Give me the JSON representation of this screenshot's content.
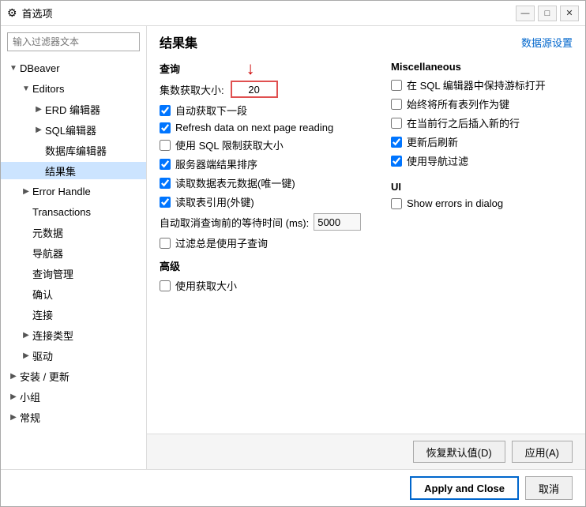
{
  "window": {
    "title": "首选项",
    "icon": "⚙"
  },
  "search": {
    "placeholder": "输入过滤器文本"
  },
  "sidebar": {
    "items": [
      {
        "id": "dbeaver",
        "label": "DBeaver",
        "level": 1,
        "expanded": true,
        "expandIcon": "▼"
      },
      {
        "id": "editors",
        "label": "Editors",
        "level": 2,
        "expanded": true,
        "expandIcon": "▼"
      },
      {
        "id": "erd",
        "label": "ERD 编辑器",
        "level": 3,
        "expandIcon": ""
      },
      {
        "id": "sql",
        "label": "SQL编辑器",
        "level": 3,
        "expandIcon": ""
      },
      {
        "id": "dbeditor",
        "label": "数据库编辑器",
        "level": 3,
        "expandIcon": ""
      },
      {
        "id": "results",
        "label": "结果集",
        "level": 3,
        "expandIcon": "",
        "selected": true
      },
      {
        "id": "errorhandle",
        "label": "Error Handle",
        "level": 2,
        "expandIcon": "▶"
      },
      {
        "id": "transactions",
        "label": "Transactions",
        "level": 2,
        "expandIcon": ""
      },
      {
        "id": "metadata",
        "label": "元数据",
        "level": 2,
        "expandIcon": ""
      },
      {
        "id": "navigator",
        "label": "导航器",
        "level": 2,
        "expandIcon": ""
      },
      {
        "id": "querymanager",
        "label": "查询管理",
        "level": 2,
        "expandIcon": ""
      },
      {
        "id": "confirm",
        "label": "确认",
        "level": 2,
        "expandIcon": ""
      },
      {
        "id": "connect",
        "label": "连接",
        "level": 2,
        "expandIcon": ""
      },
      {
        "id": "connecttype",
        "label": "连接类型",
        "level": 2,
        "expandIcon": "▶"
      },
      {
        "id": "driver",
        "label": "驱动",
        "level": 2,
        "expandIcon": "▶"
      },
      {
        "id": "install",
        "label": "安装 / 更新",
        "level": 1,
        "expandIcon": "▶"
      },
      {
        "id": "group",
        "label": "小组",
        "level": 1,
        "expandIcon": "▶"
      },
      {
        "id": "general",
        "label": "常规",
        "level": 1,
        "expandIcon": "▶"
      }
    ]
  },
  "panel": {
    "title": "结果集",
    "datasource_link": "数据源设置",
    "query_section": "查询",
    "fetch_size_label": "集数获取大小:",
    "fetch_size_value": "20",
    "checkboxes_left": [
      {
        "id": "auto_fetch",
        "label": "自动获取下一段",
        "checked": true
      },
      {
        "id": "refresh_data",
        "label": "Refresh data on next page reading",
        "checked": true
      },
      {
        "id": "sql_limit",
        "label": "使用 SQL 限制获取大小",
        "checked": false
      },
      {
        "id": "server_sort",
        "label": "服务器端结果排序",
        "checked": true
      },
      {
        "id": "read_metadata",
        "label": "读取数据表元数据(唯一键)",
        "checked": true
      },
      {
        "id": "read_refs",
        "label": "读取表引用(外键)",
        "checked": true
      }
    ],
    "timeout_label": "自动取消查询前的等待时间 (ms):",
    "timeout_value": "5000",
    "filter_subquery": {
      "id": "filter_sub",
      "label": "过滤总是使用子查询",
      "checked": false
    },
    "advanced_section": "高级",
    "use_max_size": {
      "id": "use_max",
      "label": "使用获取大小",
      "checked": false
    },
    "misc_section": "Miscellaneous",
    "checkboxes_right": [
      {
        "id": "keep_cursor",
        "label": "在 SQL 编辑器中保持游标打开",
        "checked": false
      },
      {
        "id": "all_columns_key",
        "label": "始终将所有表列作为键",
        "checked": false
      },
      {
        "id": "insert_after",
        "label": "在当前行之后插入新的行",
        "checked": false
      },
      {
        "id": "refresh_after",
        "label": "更新后刷新",
        "checked": true
      },
      {
        "id": "nav_filter",
        "label": "使用导航过滤",
        "checked": true
      }
    ],
    "ui_section": "UI",
    "show_errors": {
      "id": "show_errors",
      "label": "Show errors in dialog",
      "checked": false
    },
    "buttons": {
      "restore": "恢复默认值(D)",
      "apply": "应用(A)"
    },
    "bottom_buttons": {
      "apply_close": "Apply and Close",
      "cancel": "取消"
    }
  }
}
